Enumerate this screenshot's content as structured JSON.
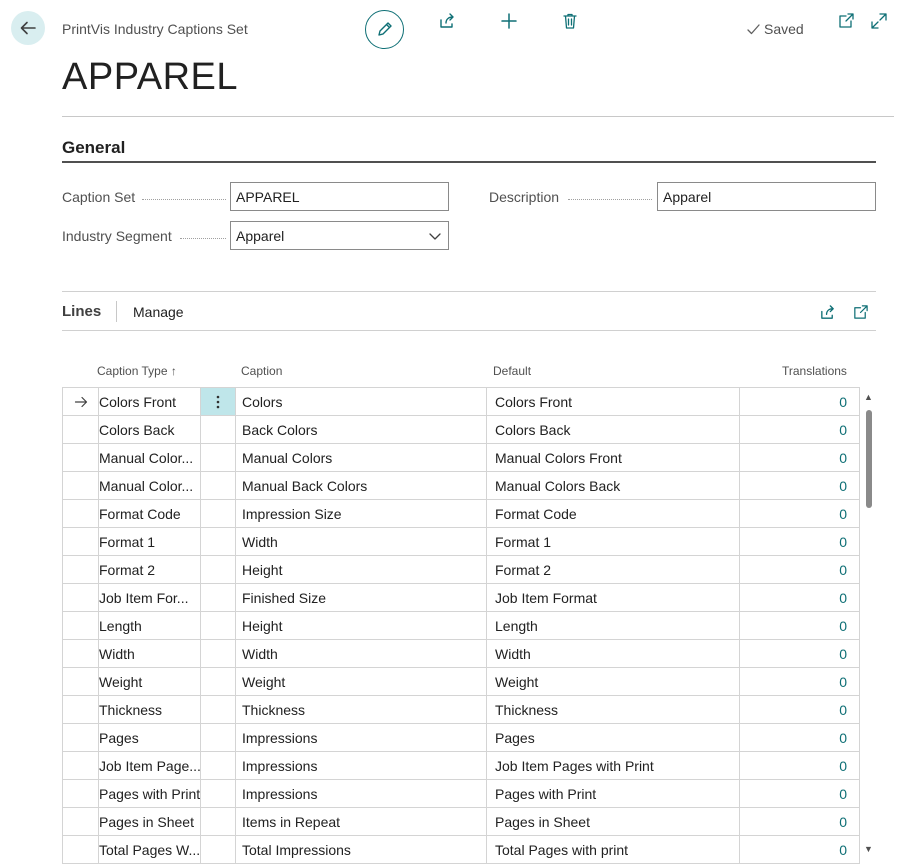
{
  "header": {
    "entity_type": "PrintVis Industry Captions Set",
    "saved_label": "Saved",
    "page_title": "APPAREL"
  },
  "general": {
    "section_title": "General",
    "caption_set_label": "Caption Set",
    "caption_set_value": "APPAREL",
    "description_label": "Description",
    "description_value": "Apparel",
    "industry_segment_label": "Industry Segment",
    "industry_segment_value": "Apparel"
  },
  "lines": {
    "title": "Lines",
    "manage_label": "Manage",
    "columns": {
      "caption_type": "Caption Type",
      "sort_indicator": "↑",
      "caption": "Caption",
      "default": "Default",
      "translations": "Translations"
    },
    "rows": [
      {
        "caption_type": "Colors Front",
        "caption": "Colors",
        "default": "Colors Front",
        "translations": "0"
      },
      {
        "caption_type": "Colors Back",
        "caption": "Back Colors",
        "default": "Colors Back",
        "translations": "0"
      },
      {
        "caption_type": "Manual Color...",
        "caption": "Manual Colors",
        "default": "Manual Colors Front",
        "translations": "0"
      },
      {
        "caption_type": "Manual Color...",
        "caption": "Manual Back Colors",
        "default": "Manual Colors Back",
        "translations": "0"
      },
      {
        "caption_type": "Format Code",
        "caption": "Impression Size",
        "default": "Format Code",
        "translations": "0"
      },
      {
        "caption_type": "Format 1",
        "caption": "Width",
        "default": "Format 1",
        "translations": "0"
      },
      {
        "caption_type": "Format 2",
        "caption": "Height",
        "default": "Format 2",
        "translations": "0"
      },
      {
        "caption_type": "Job Item For...",
        "caption": "Finished Size",
        "default": "Job Item Format",
        "translations": "0"
      },
      {
        "caption_type": "Length",
        "caption": "Height",
        "default": "Length",
        "translations": "0"
      },
      {
        "caption_type": "Width",
        "caption": "Width",
        "default": "Width",
        "translations": "0"
      },
      {
        "caption_type": "Weight",
        "caption": "Weight",
        "default": "Weight",
        "translations": "0"
      },
      {
        "caption_type": "Thickness",
        "caption": "Thickness",
        "default": "Thickness",
        "translations": "0"
      },
      {
        "caption_type": "Pages",
        "caption": "Impressions",
        "default": "Pages",
        "translations": "0"
      },
      {
        "caption_type": "Job Item Page...",
        "caption": "Impressions",
        "default": "Job Item Pages with Print",
        "translations": "0"
      },
      {
        "caption_type": "Pages with Print",
        "caption": "Impressions",
        "default": "Pages with Print",
        "translations": "0"
      },
      {
        "caption_type": "Pages in Sheet",
        "caption": "Items in Repeat",
        "default": "Pages in Sheet",
        "translations": "0"
      },
      {
        "caption_type": "Total Pages W...",
        "caption": "Total Impressions",
        "default": "Total Pages with print",
        "translations": "0"
      }
    ]
  },
  "icons": {
    "back": "arrow-left-icon",
    "edit": "pencil-icon",
    "share": "share-icon",
    "new": "plus-icon",
    "delete": "trash-icon",
    "saved": "checkmark-icon",
    "open_new_window": "open-new-window-icon",
    "expand": "expand-icon",
    "row_selected": "arrow-right-icon",
    "row_menu": "vertical-ellipsis-icon",
    "dropdown": "chevron-down-icon"
  },
  "colors": {
    "accent": "#0e6f75",
    "back_button_bg": "#d9eef0",
    "selected_cell_bg": "#bfe6ea"
  }
}
